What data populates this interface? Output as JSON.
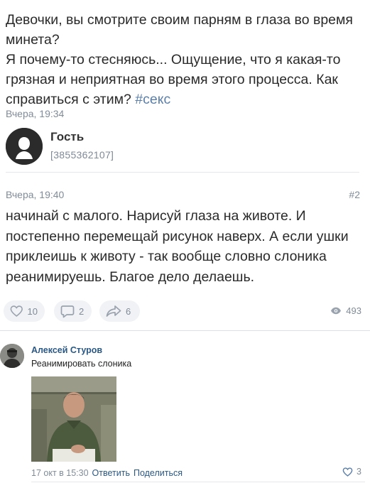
{
  "question": {
    "text": "Девочки, вы смотрите своим парням в глаза во время минета?\nЯ почему-то стесняюсь... Ощущение, что я какая-то грязная и неприятная во время этого процесса. Как справиться с этим?",
    "hashtag": "#секс",
    "time": "Вчера, 19:34"
  },
  "guest": {
    "name": "Гость",
    "id": "[3855362107]"
  },
  "answer": {
    "time": "Вчера, 19:40",
    "number": "#2",
    "text": "начинай с малого. Нарисуй глаза на животе. И постепенно перемещай рисунок наверх. А если ушки приклеишь к животу - так вообще словно слоника реанимируешь. Благое дело делаешь."
  },
  "actions": {
    "likes": "10",
    "comments": "2",
    "shares": "6",
    "views": "493"
  },
  "comment": {
    "author": "Алексей Стуров",
    "text": "Реанимировать слоника",
    "date": "17 окт в 15:30",
    "reply": "Ответить",
    "share": "Поделиться",
    "likes": "3"
  },
  "icons": [
    "heart-icon",
    "comment-icon",
    "share-icon",
    "eye-icon"
  ],
  "colors": {
    "link": "#2a5885",
    "muted": "#818c99",
    "hashtag": "#5b7fa8",
    "pill": "#f0f2f5"
  }
}
